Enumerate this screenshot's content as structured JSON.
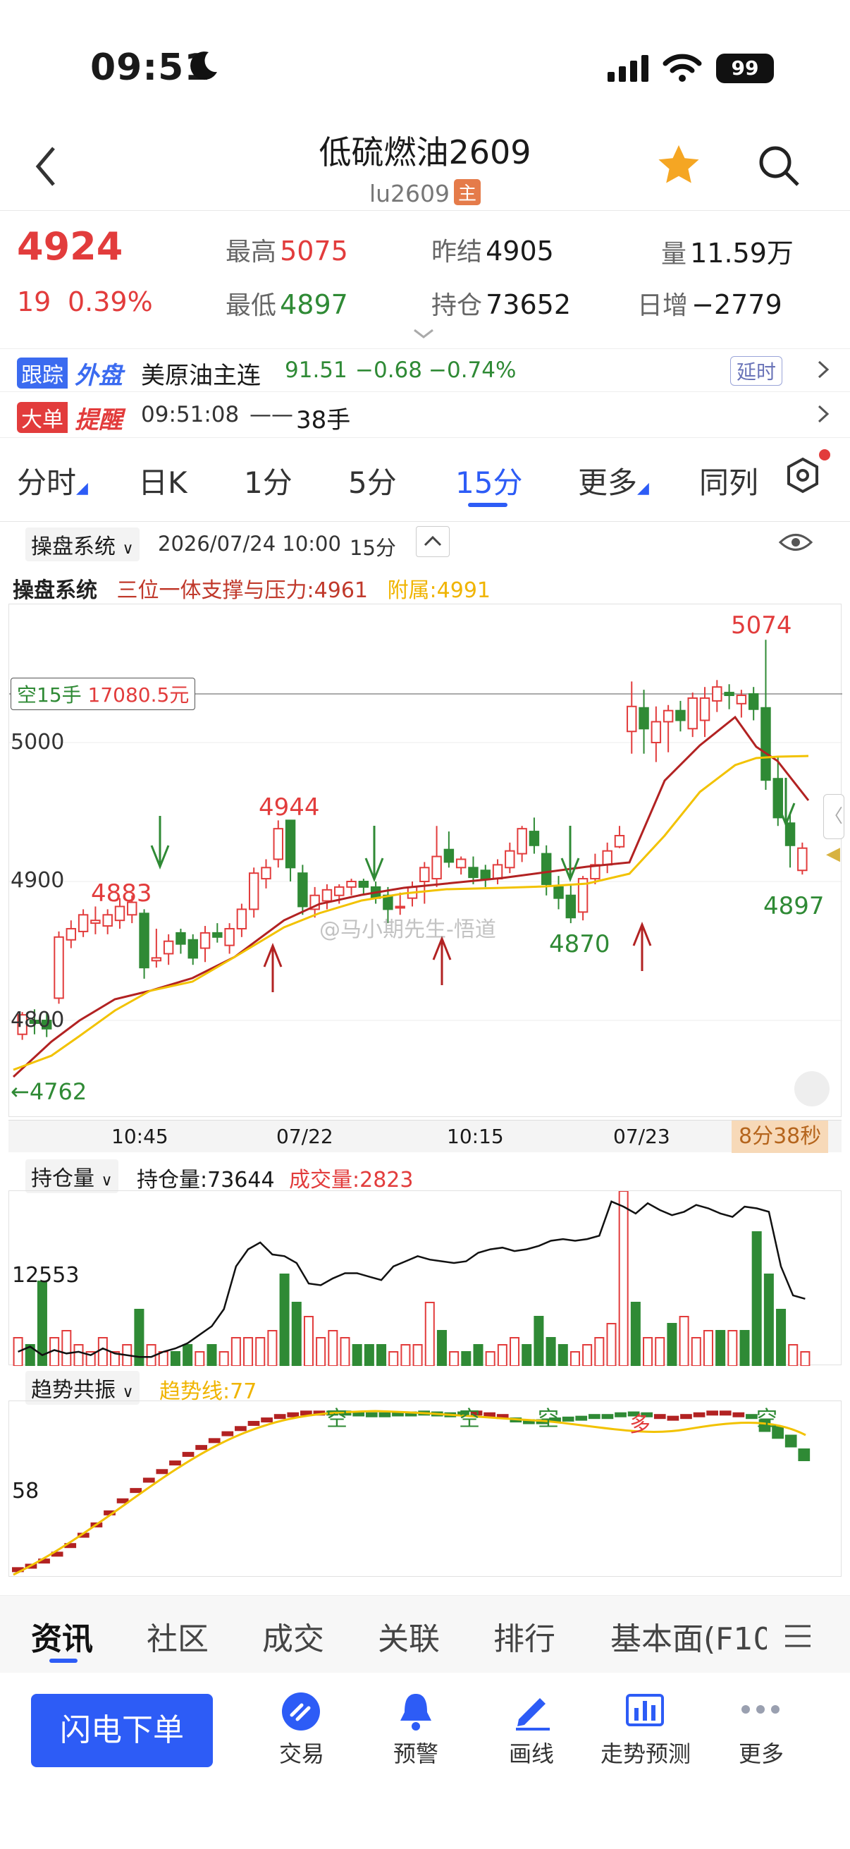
{
  "status_bar": {
    "time": "09:51",
    "battery": "99"
  },
  "header": {
    "title": "低硫燃油2609",
    "code": "lu2609",
    "code_tag": "主"
  },
  "quote": {
    "last": "4924",
    "change": "19",
    "change_pct": "0.39%",
    "high_label": "最高",
    "high": "5075",
    "low_label": "最低",
    "low": "4897",
    "prev_settle_label": "昨结",
    "prev_settle": "4905",
    "open_interest_label": "持仓",
    "open_interest": "73652",
    "volume_label": "量",
    "volume": "11.59万",
    "daily_add_label": "日增",
    "daily_add": "−2779"
  },
  "ticker": {
    "badge_a": "跟踪",
    "badge_b": "外盘",
    "name": "美原油主连",
    "price": "91.51",
    "change": "−0.68",
    "pct": "−0.74%",
    "delay": "延时"
  },
  "alert": {
    "badge_a": "大单",
    "badge_b": "提醒",
    "time": "09:51:08",
    "dash": "——",
    "qty": "38手"
  },
  "period_tabs": [
    {
      "label": "分时",
      "caret": true
    },
    {
      "label": "日K"
    },
    {
      "label": "1分"
    },
    {
      "label": "5分"
    },
    {
      "label": "15分",
      "active": true
    },
    {
      "label": "更多",
      "caret": true
    },
    {
      "label": "同列"
    }
  ],
  "chart_toolbar": {
    "system": "操盘系统",
    "datetime": "2026/07/24 10:00",
    "period": "15分"
  },
  "indicator_row": {
    "name": "操盘系统",
    "line_a": "三位一体支撑与压力:4961",
    "line_b": "附属:4991"
  },
  "main_chart": {
    "y_ticks": [
      "5000",
      "4900",
      "4800"
    ],
    "x_ticks": [
      "10:45",
      "07/22",
      "10:15",
      "07/23"
    ],
    "position_label": "空15手",
    "position_value": "17080.5元",
    "annotations": [
      "5074",
      "4944",
      "4883",
      "4870",
      "4897",
      "4762"
    ],
    "countdown": "8分38秒",
    "watermark": "@马小期先生-悟道"
  },
  "volume_panel": {
    "selector": "持仓量",
    "oi": "持仓量:73644",
    "vol": "成交量:2823",
    "y_tick": "12553"
  },
  "trend_panel": {
    "selector": "趋势共振",
    "line": "趋势线:77",
    "y_tick": "58",
    "marks": [
      "空",
      "空",
      "空",
      "多",
      "空"
    ]
  },
  "bottom_tabs": [
    "资讯",
    "社区",
    "成交",
    "关联",
    "排行",
    "基本面(F10"
  ],
  "nav": {
    "order_button": "闪电下单",
    "items": [
      "交易",
      "预警",
      "画线",
      "走势预测",
      "更多"
    ]
  },
  "chart_data": {
    "type": "candlestick",
    "candles": [
      [
        4790,
        4804,
        4786,
        4806
      ],
      [
        4800,
        4798,
        4790,
        4808
      ],
      [
        4800,
        4794,
        4788,
        4806
      ],
      [
        4816,
        4860,
        4812,
        4864
      ],
      [
        4858,
        4866,
        4852,
        4872
      ],
      [
        4864,
        4876,
        4860,
        4880
      ],
      [
        4870,
        4872,
        4862,
        4882
      ],
      [
        4868,
        4876,
        4862,
        4880
      ],
      [
        4872,
        4882,
        4866,
        4888
      ],
      [
        4876,
        4885,
        4870,
        4890
      ],
      [
        4877,
        4838,
        4830,
        4880
      ],
      [
        4843,
        4845,
        4838,
        4866
      ],
      [
        4848,
        4857,
        4840,
        4862
      ],
      [
        4863,
        4855,
        4848,
        4866
      ],
      [
        4858,
        4845,
        4840,
        4862
      ],
      [
        4852,
        4863,
        4842,
        4868
      ],
      [
        4863,
        4860,
        4856,
        4870
      ],
      [
        4854,
        4866,
        4848,
        4870
      ],
      [
        4866,
        4880,
        4860,
        4884
      ],
      [
        4880,
        4906,
        4874,
        4910
      ],
      [
        4902,
        4910,
        4895,
        4916
      ],
      [
        4916,
        4938,
        4910,
        4944
      ],
      [
        4944,
        4910,
        4900,
        4944
      ],
      [
        4906,
        4882,
        4876,
        4912
      ],
      [
        4880,
        4890,
        4874,
        4896
      ],
      [
        4886,
        4894,
        4880,
        4898
      ],
      [
        4890,
        4896,
        4884,
        4898
      ],
      [
        4896,
        4900,
        4890,
        4902
      ],
      [
        4900,
        4896,
        4890,
        4902
      ],
      [
        4896,
        4888,
        4884,
        4900
      ],
      [
        4890,
        4880,
        4870,
        4896
      ],
      [
        4882,
        4882,
        4876,
        4892
      ],
      [
        4888,
        4896,
        4882,
        4900
      ],
      [
        4900,
        4910,
        4884,
        4914
      ],
      [
        4902,
        4918,
        4896,
        4940
      ],
      [
        4923,
        4914,
        4910,
        4936
      ],
      [
        4910,
        4916,
        4905,
        4918
      ],
      [
        4910,
        4903,
        4898,
        4918
      ],
      [
        4908,
        4902,
        4896,
        4912
      ],
      [
        4902,
        4912,
        4898,
        4916
      ],
      [
        4910,
        4922,
        4906,
        4928
      ],
      [
        4920,
        4938,
        4914,
        4940
      ],
      [
        4936,
        4926,
        4920,
        4946
      ],
      [
        4920,
        4898,
        4890,
        4926
      ],
      [
        4896,
        4888,
        4880,
        4904
      ],
      [
        4890,
        4874,
        4870,
        4898
      ],
      [
        4878,
        4902,
        4872,
        4904
      ],
      [
        4902,
        4912,
        4898,
        4920
      ],
      [
        4912,
        4922,
        4906,
        4928
      ],
      [
        4925,
        4933,
        4924,
        4940
      ],
      [
        5008,
        5026,
        4992,
        5044
      ],
      [
        5025,
        5010,
        4992,
        5038
      ],
      [
        5000,
        5015,
        4986,
        5026
      ],
      [
        5015,
        5023,
        4993,
        5027
      ],
      [
        5023,
        5016,
        5008,
        5030
      ],
      [
        5010,
        5032,
        5004,
        5036
      ],
      [
        5016,
        5032,
        5004,
        5040
      ],
      [
        5030,
        5040,
        5022,
        5045
      ],
      [
        5036,
        5034,
        5024,
        5042
      ],
      [
        5028,
        5034,
        5018,
        5038
      ],
      [
        5035,
        5024,
        5016,
        5040
      ],
      [
        5025,
        4973,
        4966,
        5074
      ],
      [
        4974,
        4946,
        4940,
        4990
      ],
      [
        4942,
        4926,
        4910,
        4950
      ],
      [
        4908,
        4924,
        4905,
        4928
      ]
    ],
    "oi": [
      12300,
      12330,
      12280,
      12310,
      12290,
      12300,
      12280,
      12320,
      12290,
      12280,
      12270,
      12270,
      12300,
      12320,
      12350,
      12400,
      12450,
      12550,
      12800,
      12900,
      12940,
      12870,
      12860,
      12820,
      12700,
      12690,
      12730,
      12760,
      12760,
      12740,
      12720,
      12800,
      12830,
      12860,
      12840,
      12830,
      12820,
      12830,
      12880,
      12900,
      12910,
      12890,
      12900,
      12920,
      12950,
      12960,
      12950,
      12960,
      12980,
      13180,
      13150,
      13110,
      13170,
      13130,
      13100,
      13120,
      13160,
      13140,
      13110,
      13090,
      13150,
      13140,
      13120,
      12800,
      12630,
      12610
    ],
    "vol_note": "成交量 bars shown relative"
  }
}
